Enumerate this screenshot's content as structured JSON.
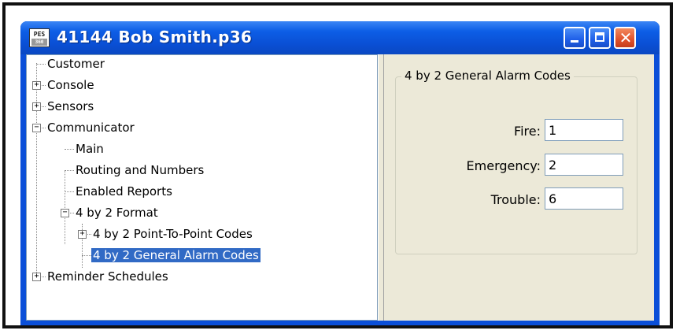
{
  "window": {
    "title": "41144 Bob Smith.p36",
    "icon_top": "PES",
    "icon_bottom": "360"
  },
  "tree": {
    "items": [
      {
        "label": "Customer",
        "expander": ""
      },
      {
        "label": "Console",
        "expander": "+"
      },
      {
        "label": "Sensors",
        "expander": "+"
      },
      {
        "label": "Communicator",
        "expander": "−"
      },
      {
        "label": "Main",
        "expander": ""
      },
      {
        "label": "Routing and Numbers",
        "expander": ""
      },
      {
        "label": "Enabled Reports",
        "expander": ""
      },
      {
        "label": "4 by 2 Format",
        "expander": "−"
      },
      {
        "label": "4 by 2 Point-To-Point Codes",
        "expander": "+"
      },
      {
        "label": "4 by 2 General Alarm Codes",
        "expander": "",
        "selected": true
      },
      {
        "label": "Reminder Schedules",
        "expander": "+"
      }
    ]
  },
  "panel": {
    "group_title": "4 by 2 General Alarm Codes",
    "fields": [
      {
        "label": "Fire:",
        "value": "1"
      },
      {
        "label": "Emergency:",
        "value": "2"
      },
      {
        "label": "Trouble:",
        "value": "6"
      }
    ]
  },
  "colors": {
    "titlebar": "#0a4fd4",
    "selection": "#316ac5",
    "close_button": "#e0512b"
  }
}
